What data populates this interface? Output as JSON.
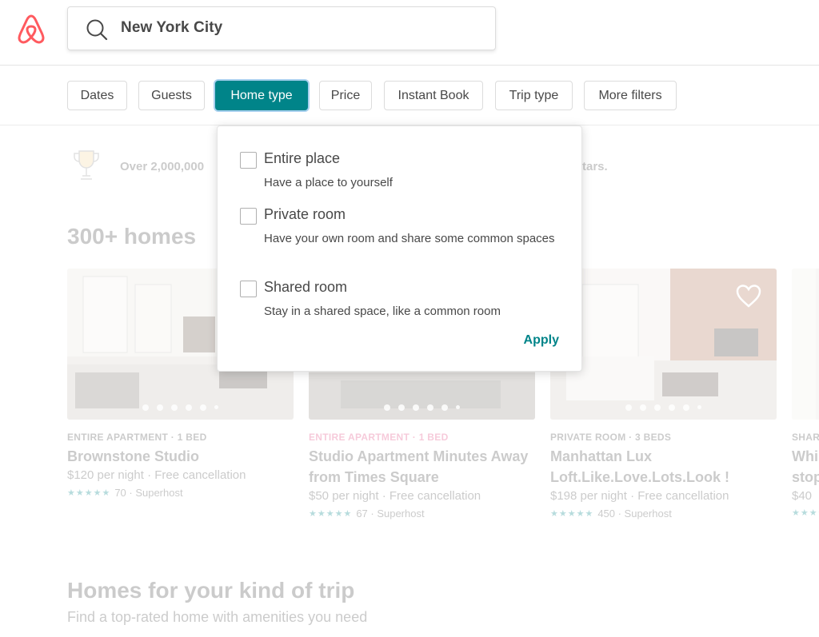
{
  "header": {
    "logo_icon": "airbnb-logo-icon",
    "search": {
      "icon": "search-icon",
      "value": "New York City"
    }
  },
  "filters": [
    {
      "label": "Dates",
      "active": false
    },
    {
      "label": "Guests",
      "active": false
    },
    {
      "label": "Home type",
      "active": true
    },
    {
      "label": "Price",
      "active": false
    },
    {
      "label": "Instant Book",
      "active": false
    },
    {
      "label": "Trip type",
      "active": false
    },
    {
      "label": "More filters",
      "active": false
    }
  ],
  "dropdown": {
    "options": [
      {
        "label": "Entire place",
        "description": "Have a place to yourself",
        "checked": false
      },
      {
        "label": "Private room",
        "description": "Have your own room and share some common spaces",
        "checked": false
      },
      {
        "label": "Shared room",
        "description": "Stay in a shared space, like a common room",
        "checked": false
      }
    ],
    "apply_label": "Apply"
  },
  "background": {
    "notice_left": "Over 2,000,000",
    "notice_right": "tars.",
    "section_title": "300+ homes",
    "listings": [
      {
        "kicker": "ENTIRE APARTMENT · 1 BED",
        "title": "Brownstone Studio",
        "price": "$120  per night · Free cancellation",
        "rating_count": "70 · Superhost",
        "kicker_color": "#484848"
      },
      {
        "kicker": "ENTIRE APARTMENT · 1 BED",
        "title": "Studio Apartment Minutes Away from Times Square",
        "price": "$50  per night · Free cancellation",
        "rating_count": "67 · Superhost",
        "kicker_color": "#e2457c"
      },
      {
        "kicker": "PRIVATE ROOM · 3 BEDS",
        "title": "Manhattan Lux Loft.Like.Love.Lots.Look !",
        "price": "$198  per night · Free cancellation",
        "rating_count": "450 · Superhost",
        "kicker_color": "#484848"
      }
    ],
    "partial_listing": {
      "kicker": "SHAR",
      "title_line1": "Whi",
      "title_line2": "stop",
      "price": "$40"
    },
    "stars": "★★★★★",
    "kind_title": "Homes for your kind of trip",
    "kind_subtitle": "Find a top-rated home with amenities you need"
  },
  "colors": {
    "brand": "#ff5a5f",
    "accent": "#008489",
    "text": "#484848",
    "pink_kicker": "#e2457c"
  }
}
